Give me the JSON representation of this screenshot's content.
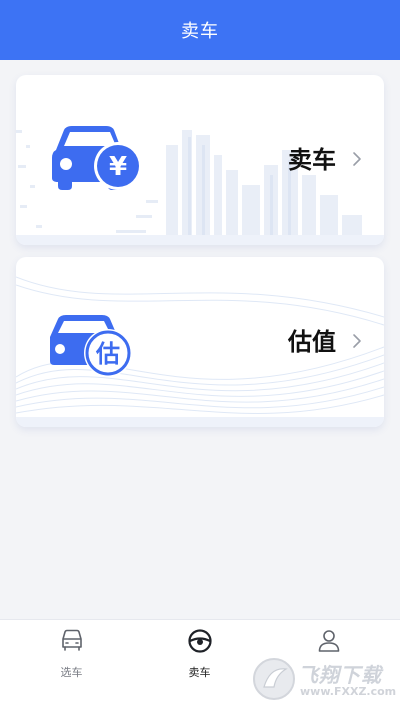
{
  "header": {
    "title": "卖车"
  },
  "cards": [
    {
      "label": "卖车",
      "icon": "car-yen-icon"
    },
    {
      "label": "估值",
      "icon": "car-estimate-icon",
      "icon_text": "估"
    }
  ],
  "card_icons": {
    "sell_badge_symbol": "¥"
  },
  "tabs": [
    {
      "label": "选车",
      "icon": "car-front-icon",
      "active": false
    },
    {
      "label": "卖车",
      "icon": "steering-wheel-icon",
      "active": true
    },
    {
      "label": "",
      "icon": "user-icon",
      "active": false
    }
  ],
  "watermark": {
    "text": "飞翔下载",
    "url": "www.FXXZ.com"
  },
  "colors": {
    "primary": "#3d73f4",
    "icon_blue": "#3d6cf0",
    "background": "#f3f4f7"
  }
}
